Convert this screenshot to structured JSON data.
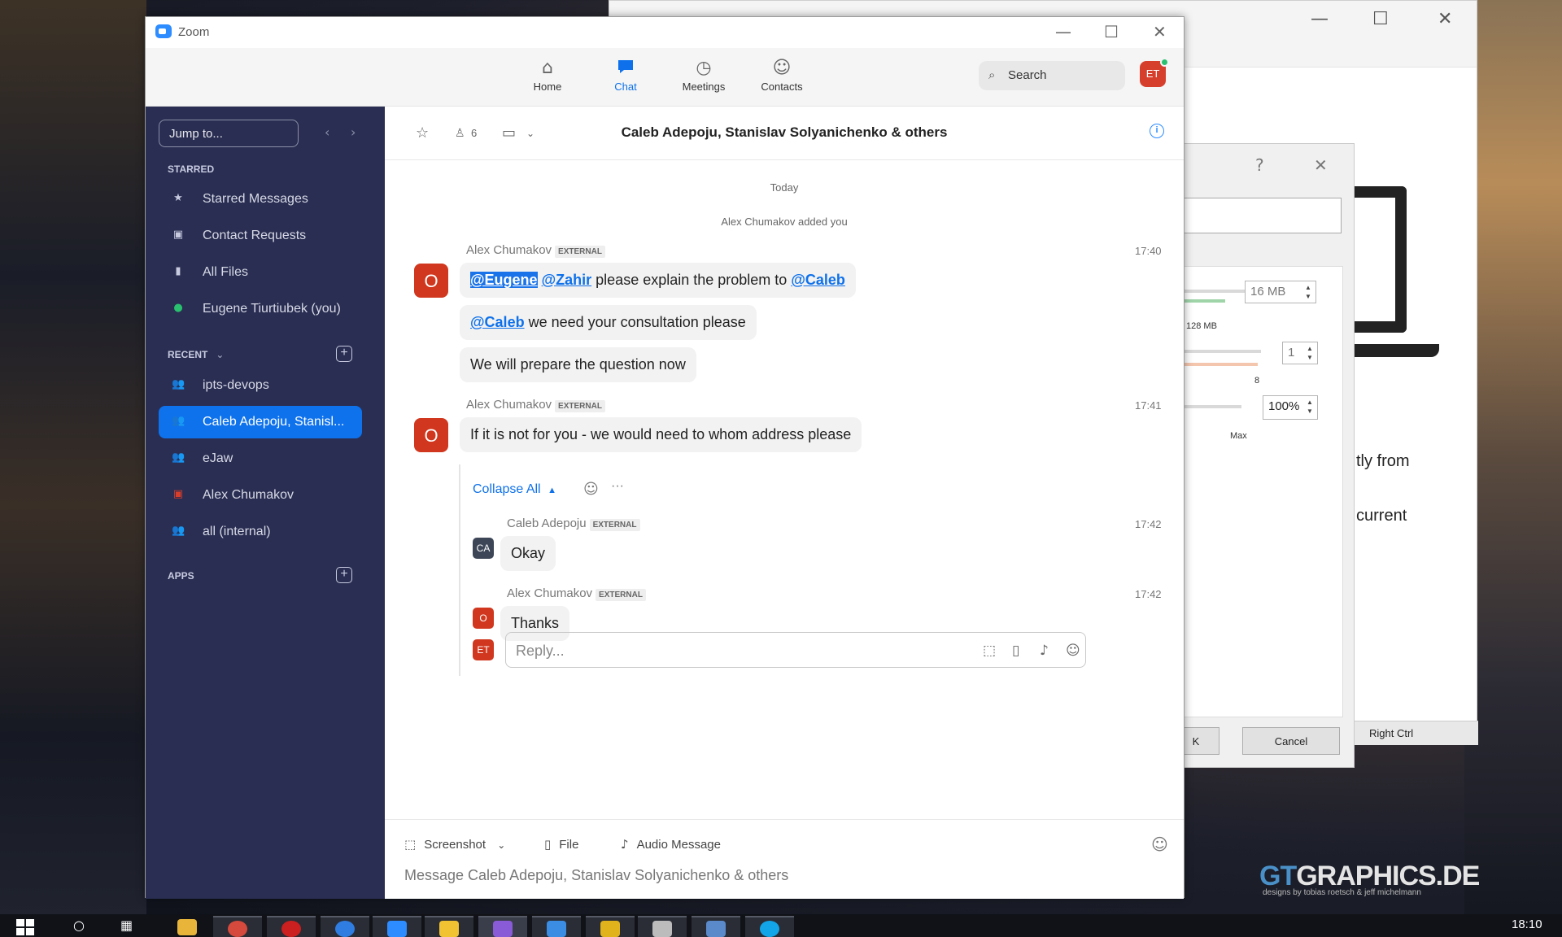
{
  "background_window": {
    "text1": "tly from",
    "text2": "current",
    "status_key": "Right Ctrl"
  },
  "dialog": {
    "help": "?",
    "close": "✕",
    "mem_value": "16 MB",
    "mem_label": "128 MB",
    "cpu_value": "1",
    "cpu_label": "8",
    "exec_value": "100%",
    "exec_label": "Max",
    "ok_label": "K",
    "cancel_label": "Cancel"
  },
  "window": {
    "title": "Zoom",
    "min": "—",
    "max": "☐",
    "close": "✕"
  },
  "nav": {
    "items": [
      {
        "label": "Home",
        "icon": "⌂"
      },
      {
        "label": "Chat",
        "icon": "💬"
      },
      {
        "label": "Meetings",
        "icon": "◷"
      },
      {
        "label": "Contacts",
        "icon": "☺"
      }
    ],
    "search_placeholder": "Search",
    "avatar": "ET"
  },
  "sidebar": {
    "jump_placeholder": "Jump to...",
    "starred_header": "STARRED",
    "starred": [
      {
        "label": "Starred Messages",
        "icon": "★"
      },
      {
        "label": "Contact Requests",
        "icon": "▣"
      },
      {
        "label": "All Files",
        "icon": "▮"
      },
      {
        "label": "Eugene Tiurtiubek (you)",
        "icon": "●"
      }
    ],
    "recent_header": "RECENT",
    "recent": [
      {
        "label": "ipts-devops",
        "icon": "👥"
      },
      {
        "label": "Caleb Adepoju, Stanisl...",
        "icon": "👥"
      },
      {
        "label": "eJaw",
        "icon": "👥"
      },
      {
        "label": "Alex Chumakov",
        "icon": "▣"
      },
      {
        "label": "all (internal)",
        "icon": "👥"
      }
    ],
    "apps_header": "APPS"
  },
  "chat": {
    "member_count": "6",
    "title": "Caleb Adepoju, Stanislav Solyanichenko & others",
    "today": "Today",
    "system": "Alex Chumakov added you",
    "external_badge": "EXTERNAL",
    "msg1": {
      "sender": "Alex Chumakov",
      "time": "17:40",
      "avatar": "O",
      "m1_mention1": "@Eugene",
      "m1_mention2": "@Zahir",
      "m1_text": " please explain the problem to ",
      "m1_mention3": "@Caleb",
      "m2_mention": "@Caleb",
      "m2_text": " we need your consultation please",
      "m3_text": "We will prepare the question now"
    },
    "msg2": {
      "sender": "Alex Chumakov",
      "time": "17:41",
      "avatar": "O",
      "text": "If it is not for you - we would need to whom address please"
    },
    "collapse_label": "Collapse All",
    "thread": [
      {
        "sender": "Caleb Adepoju",
        "time": "17:42",
        "avatar": "CA",
        "text": "Okay"
      },
      {
        "sender": "Alex Chumakov",
        "time": "17:42",
        "avatar": "O",
        "text": "Thanks"
      }
    ],
    "reply_avatar": "ET",
    "reply_placeholder": "Reply...",
    "toolbar": {
      "screenshot": "Screenshot",
      "file": "File",
      "audio": "Audio Message"
    },
    "compose_placeholder": "Message Caleb Adepoju, Stanislav Solyanichenko & others"
  },
  "taskbar": {
    "clock": "18:10"
  },
  "watermark": {
    "main1": "GT",
    "main2": "GRAPHICS.DE",
    "sub": "designs by tobias roetsch & jeff michelmann"
  }
}
